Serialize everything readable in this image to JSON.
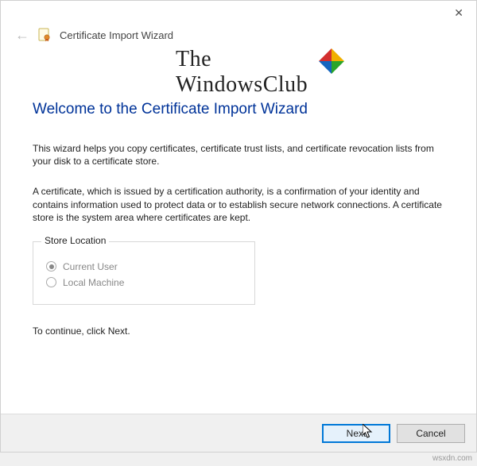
{
  "window": {
    "title": "Certificate Import Wizard"
  },
  "watermark": {
    "line1": "The",
    "line2": "WindowsClub"
  },
  "content": {
    "heading": "Welcome to the Certificate Import Wizard",
    "para1": "This wizard helps you copy certificates, certificate trust lists, and certificate revocation lists from your disk to a certificate store.",
    "para2": "A certificate, which is issued by a certification authority, is a confirmation of your identity and contains information used to protect data or to establish secure network connections. A certificate store is the system area where certificates are kept.",
    "group_label": "Store Location",
    "radio_current_user": "Current User",
    "radio_local_machine": "Local Machine",
    "continue_hint": "To continue, click Next."
  },
  "buttons": {
    "next": "Next",
    "cancel": "Cancel"
  },
  "attribution": "wsxdn.com"
}
